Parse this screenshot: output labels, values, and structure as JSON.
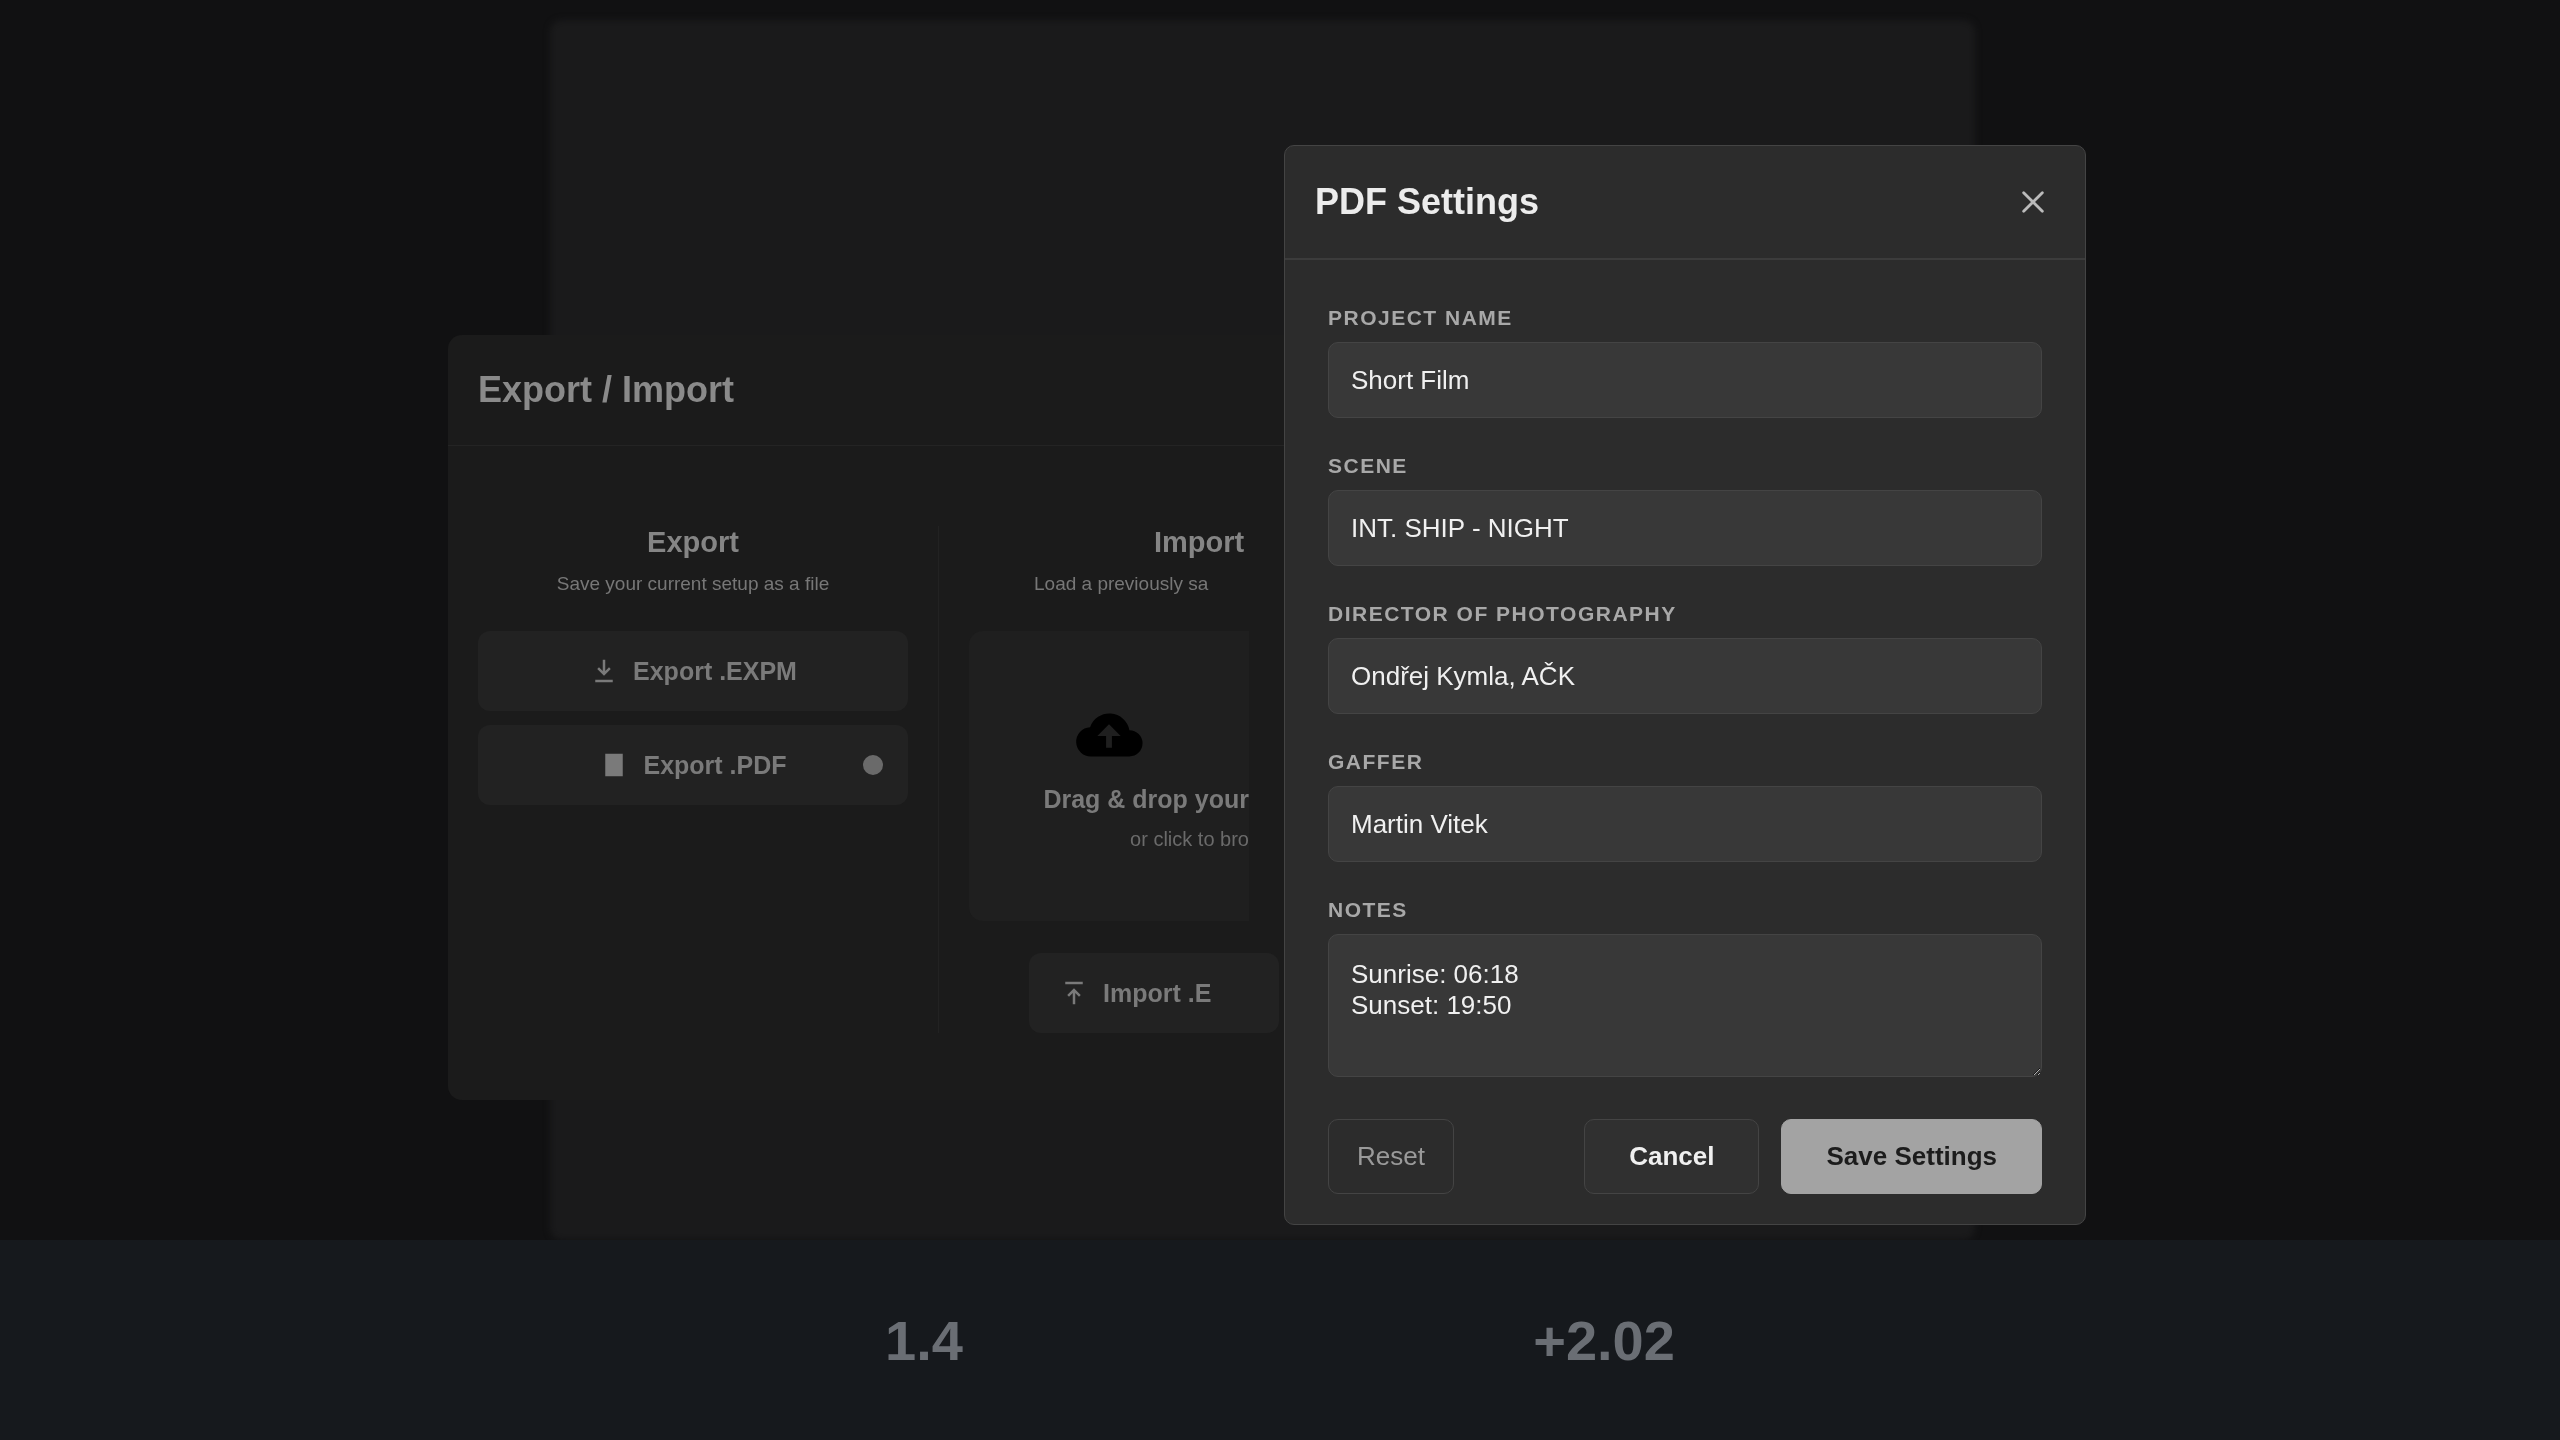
{
  "background_panel": {
    "title": "Export / Import",
    "export": {
      "heading": "Export",
      "subtitle": "Save your current setup as a file",
      "buttons": [
        "Export .EXPM",
        "Export .PDF"
      ]
    },
    "import": {
      "heading": "Import",
      "subtitle": "Load a previously sa",
      "drop_title": "Drag & drop your",
      "drop_hint": "or click to bro",
      "button": "Import .E"
    }
  },
  "stats": [
    "1.4",
    "+2.02"
  ],
  "dialog": {
    "title": "PDF Settings",
    "fields": [
      {
        "label": "PROJECT NAME",
        "value": "Short Film",
        "kind": "input"
      },
      {
        "label": "SCENE",
        "value": "INT. SHIP - NIGHT",
        "kind": "input"
      },
      {
        "label": "DIRECTOR OF PHOTOGRAPHY",
        "value": "Ondřej Kymla, AČK",
        "kind": "input"
      },
      {
        "label": "GAFFER",
        "value": "Martin Vitek",
        "kind": "input"
      },
      {
        "label": "NOTES",
        "value": "Sunrise: 06:18\nSunset: 19:50",
        "kind": "textarea"
      }
    ],
    "buttons": [
      {
        "label": "Reset",
        "kind": "ghost"
      },
      {
        "label": "Cancel",
        "kind": "secondary"
      },
      {
        "label": "Save Settings",
        "kind": "primary"
      }
    ]
  }
}
